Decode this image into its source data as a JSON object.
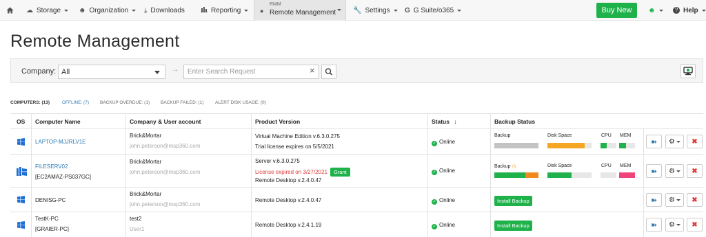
{
  "nav": {
    "items": [
      {
        "label": "Storage"
      },
      {
        "label": "Organization"
      },
      {
        "label": "Downloads"
      },
      {
        "label": "Reporting"
      },
      {
        "label": "Settings"
      },
      {
        "label": "G Suite/o365"
      }
    ],
    "rmm_small": "RMM",
    "rmm_label": "Remote Management",
    "buy_label": "Buy New",
    "help_label": "Help"
  },
  "page": {
    "title": "Remote Management"
  },
  "filter": {
    "company_label": "Company:",
    "company_value": "All",
    "search_placeholder": "Enter Search Request"
  },
  "stats": {
    "computers": "COMPUTERS: (13)",
    "offline": "OFFLINE: (7)",
    "overdue": "BACKUP OVERDUE: (1)",
    "failed": "BACKUP FAILED: (1)",
    "disk": "ALERT DISK USAGE: (0)"
  },
  "table": {
    "headers": {
      "os": "OS",
      "name": "Computer Name",
      "company": "Company & User account",
      "product": "Product Version",
      "status": "Status",
      "backup": "Backup Status"
    },
    "sub_labels": {
      "backup": "Backup",
      "disk": "Disk Space",
      "cpu": "CPU",
      "mem": "MEM"
    },
    "rows": [
      {
        "name": "LAPTOP-MJJRLV1E",
        "company": "Brick&Mortar",
        "user": "john.peterson@msp360.com",
        "product1": "Virtual Machine Edition v.6.3.0.275",
        "product2": "Trial license expires on 5/5/2021",
        "status": "Online",
        "backup_fill": 1.0,
        "disk_fill": 0.85,
        "cpu_fill": 0.4,
        "mem_fill": 0.45
      },
      {
        "name": "FILESERV02",
        "name2": "[EC2AMAZ-PS037GC]",
        "company": "Brick&Mortar",
        "user": "john.peterson@msp360.com",
        "product1": "Server v.6.3.0.275",
        "product2": "License expired on 3/27/2021",
        "grant": "Grant",
        "product3": "Remote Desktop v.2.4.0.47",
        "status": "Online",
        "backup_green": 0.7,
        "backup_orange": 0.3,
        "disk_fill": 0.55,
        "cpu_fill": 0.0,
        "mem_fill": 1.0
      },
      {
        "name": "DENISG-PC",
        "company": "Brick&Mortar",
        "user": "john.peterson@msp360.com",
        "product1": "Remote Desktop v.2.4.0.47",
        "status": "Online",
        "install": "Install Backup"
      },
      {
        "name": "TestK-PC",
        "name2": "[GRAIER-PC]",
        "company": "test2",
        "user": "User1",
        "product1": "Remote Desktop v.2.4.1.19",
        "status": "Online",
        "install": "Install Backup"
      }
    ]
  },
  "colors": {
    "accent": "#1fb24b",
    "link": "#2a7ab5",
    "orange": "#f5a623",
    "red": "#e03838",
    "pink": "#f0437a",
    "gray": "#c3c3c3"
  }
}
